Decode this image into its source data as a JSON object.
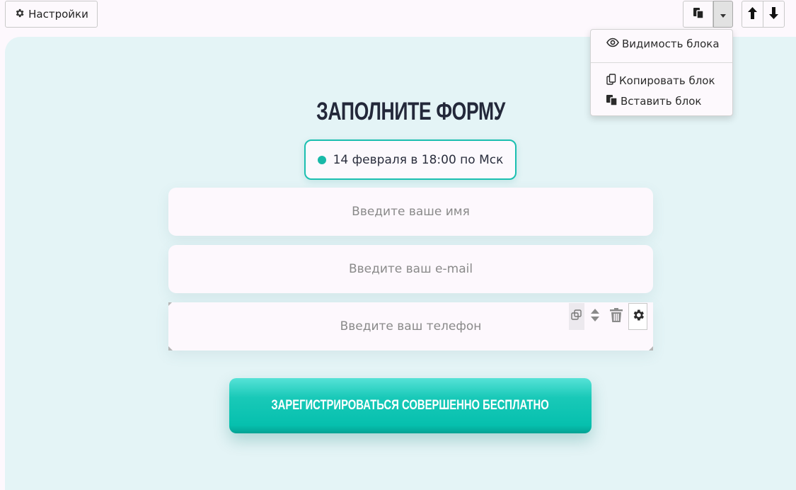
{
  "toolbar": {
    "settings_label": "Настройки",
    "icons": {
      "settings": "gear-icon",
      "paste": "paste-icon",
      "dropdown": "caret-down-icon",
      "up": "arrow-up-icon",
      "down": "arrow-down-icon"
    }
  },
  "dropdown_menu": {
    "items": [
      {
        "label": "Видимость блока",
        "icon": "eye-icon"
      },
      {
        "label": "Копировать блок",
        "icon": "copy-icon"
      },
      {
        "label": "Вставить блок",
        "icon": "paste-icon"
      }
    ]
  },
  "form": {
    "title": "ЗАПОЛНИТЕ ФОРМУ",
    "date_label": "14 февраля в 18:00 по Мск",
    "fields": [
      {
        "placeholder": "Введите ваше имя"
      },
      {
        "placeholder": "Введите ваш e-mail"
      },
      {
        "placeholder": "Введите ваш телефон"
      }
    ],
    "field_tools": [
      "copy-icon",
      "move-vertical-icon",
      "trash-icon",
      "gear-icon"
    ],
    "submit_label": "ЗАРЕГИСТРИРОВАТЬСЯ СОВЕРШЕННО БЕСПЛАТНО"
  },
  "colors": {
    "accent": "#1bbfb0",
    "block_background": "#e4f4f6",
    "page_background": "#fdf8fd",
    "title": "#23283a"
  }
}
